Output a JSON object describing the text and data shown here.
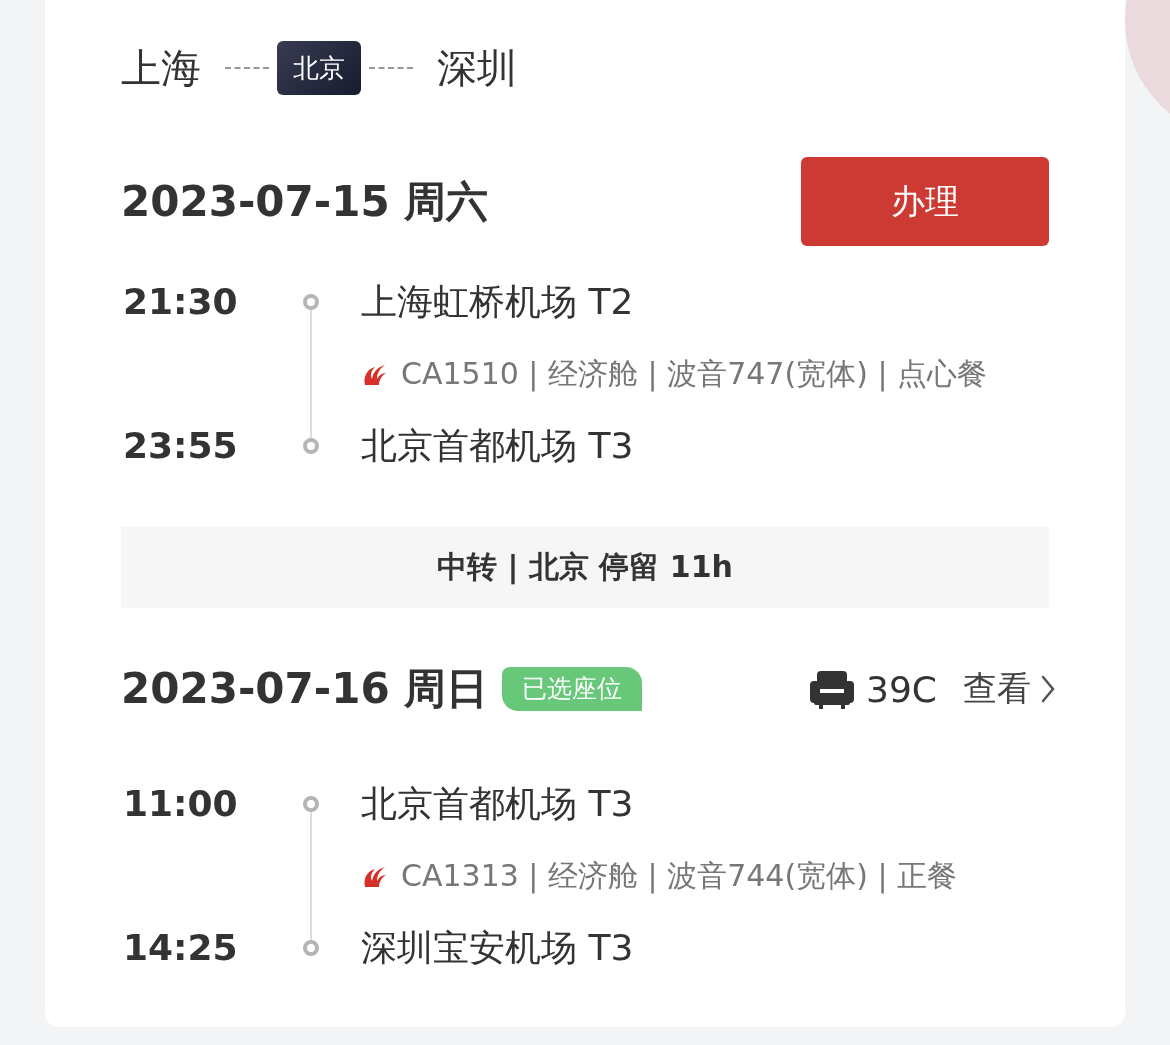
{
  "route": {
    "origin": "上海",
    "via": "北京",
    "destination": "深圳"
  },
  "segments": [
    {
      "kind": "leg",
      "date": "2023-07-15 周六",
      "action": {
        "label": "办理"
      },
      "departure": {
        "time": "21:30",
        "airport": "上海虹桥机场 T2"
      },
      "flight": "CA1510 | 经济舱 | 波音747(宽体) | 点心餐",
      "arrival": {
        "time": "23:55",
        "airport": "北京首都机场 T3"
      }
    },
    {
      "kind": "transfer",
      "text": "中转 | 北京 停留 11h"
    },
    {
      "kind": "leg",
      "date": "2023-07-16 周日",
      "badge": "已选座位",
      "seat": "39C",
      "link": "查看",
      "departure": {
        "time": "11:00",
        "airport": "北京首都机场 T3"
      },
      "flight": "CA1313 | 经济舱 | 波音744(宽体) | 正餐",
      "arrival": {
        "time": "14:25",
        "airport": "深圳宝安机场 T3"
      }
    }
  ]
}
